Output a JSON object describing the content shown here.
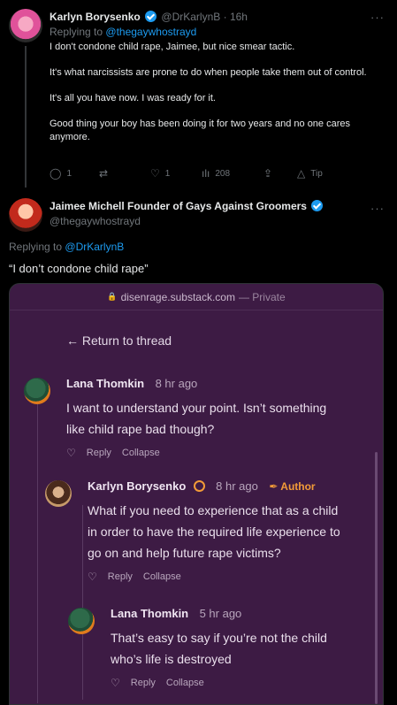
{
  "tweet1": {
    "name": "Karlyn Borysenko",
    "handle": "@DrKarlynB",
    "time": "· 16h",
    "replying_label": "Replying to",
    "replying_to": "@thegaywhostrayd",
    "paragraphs": [
      "I don't condone child rape, Jaimee, but nice smear tactic.",
      "It's what narcissists are prone to do when people take them out of control.",
      "It's all you have now. I was ready for it.",
      "Good thing your boy has been doing it for two years and no one cares anymore."
    ],
    "replies": "1",
    "likes": "1",
    "views": "208",
    "tip": "Tip",
    "more_icon": "···"
  },
  "tweet2": {
    "name": "Jaimee Michell Founder of Gays Against Groomers",
    "handle": "@thegaywhostrayd",
    "replying_label": "Replying to",
    "replying_to": "@DrKarlynB",
    "text": "“I don’t condone child rape”",
    "more_icon": "···"
  },
  "card": {
    "domain": "disenrage.substack.com",
    "privacy": "— Private",
    "return_label": "← Return to thread",
    "comments": [
      {
        "name": "Lana Thomkin",
        "time": "8 hr ago",
        "text_lines": [
          "I want to understand your point. Isn’t something",
          "like child rape bad though?"
        ],
        "reply": "Reply",
        "collapse": "Collapse"
      },
      {
        "name": "Karlyn Borysenko",
        "time": "8 hr ago",
        "author": "Author",
        "text_lines": [
          "What if you need to experience that as a child",
          "in order to have the required life experience to",
          "go on and help future rape victims?"
        ],
        "reply": "Reply",
        "collapse": "Collapse"
      },
      {
        "name": "Lana Thomkin",
        "time": "5 hr ago",
        "text_lines": [
          "That’s easy to say if you’re not the child",
          "who’s life is destroyed"
        ],
        "reply": "Reply",
        "collapse": "Collapse"
      }
    ]
  }
}
